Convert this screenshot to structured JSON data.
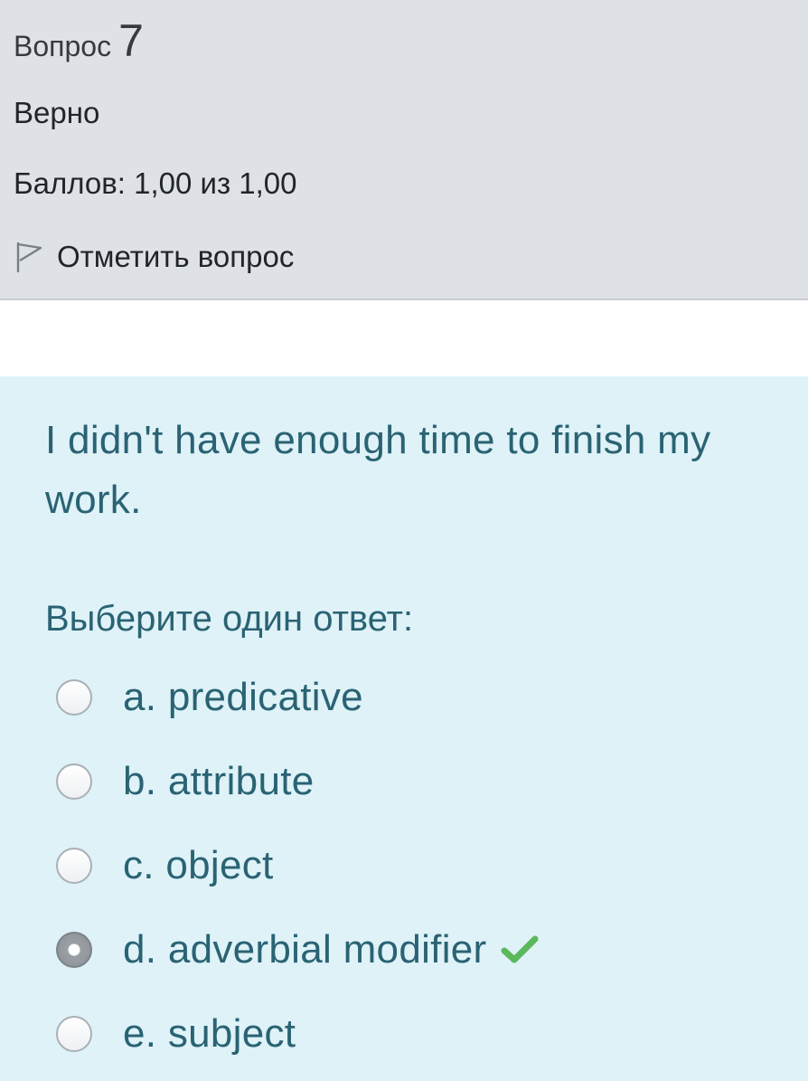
{
  "question_info": {
    "label": "Вопрос",
    "number": "7",
    "state": "Верно",
    "grade": "Баллов: 1,00 из 1,00",
    "flag_label": "Отметить вопрос",
    "flag_icon": "flag-icon"
  },
  "question": {
    "text": "I didn't have enough time to finish my work.",
    "prompt": "Выберите один ответ:",
    "answers": [
      {
        "label": "a. predicative",
        "selected": false
      },
      {
        "label": "b. attribute",
        "selected": false
      },
      {
        "label": "c. object",
        "selected": false
      },
      {
        "label": "d. adverbial modifier",
        "selected": true,
        "correct_icon": "checkmark-icon"
      },
      {
        "label": "e. subject",
        "selected": false
      }
    ]
  },
  "colors": {
    "info_bg": "#dee2e6",
    "content_bg": "#def2f8",
    "text_teal": "#2a6373",
    "check_green": "#5cb85c"
  }
}
